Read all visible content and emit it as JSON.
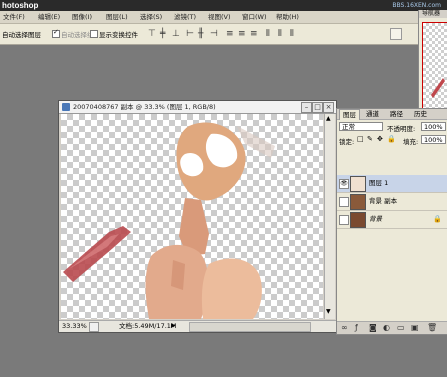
{
  "app": {
    "title_partial": "hotoshop",
    "watermark": "BBS.16XEN.com"
  },
  "menu": {
    "items": [
      "文件(F)",
      "编辑(E)",
      "图像(I)",
      "图层(L)",
      "选择(S)",
      "滤镜(T)",
      "视图(V)",
      "窗口(W)",
      "帮助(H)"
    ]
  },
  "options": {
    "auto_select_layer": "自动选择图层",
    "auto_select_group": "自动选择组",
    "show_transform": "显示变换控件"
  },
  "navigator": {
    "tab_label": "导航器"
  },
  "document": {
    "title": "20070408767 副本 @ 33.3% (图层 1, RGB/8)",
    "zoom": "33.33%",
    "doc_size": "文档:5.49M/17.1M"
  },
  "layers_panel": {
    "tabs": [
      "图层",
      "通道",
      "路径",
      "历史"
    ],
    "blend_mode": "正常",
    "opacity_label": "不透明度:",
    "opacity_value": "100%",
    "lock_label": "锁定:",
    "fill_label": "填充:",
    "fill_value": "100%",
    "layers": [
      {
        "name": "图层 1",
        "visible": true,
        "active": true
      },
      {
        "name": "背景 副本",
        "visible": false,
        "active": false
      },
      {
        "name": "背景",
        "visible": false,
        "active": false,
        "locked": true
      }
    ]
  },
  "colors": {
    "workspace": "#7a7a7a",
    "panel_bg": "#ece9d8",
    "active_layer": "#c8d4e8"
  }
}
